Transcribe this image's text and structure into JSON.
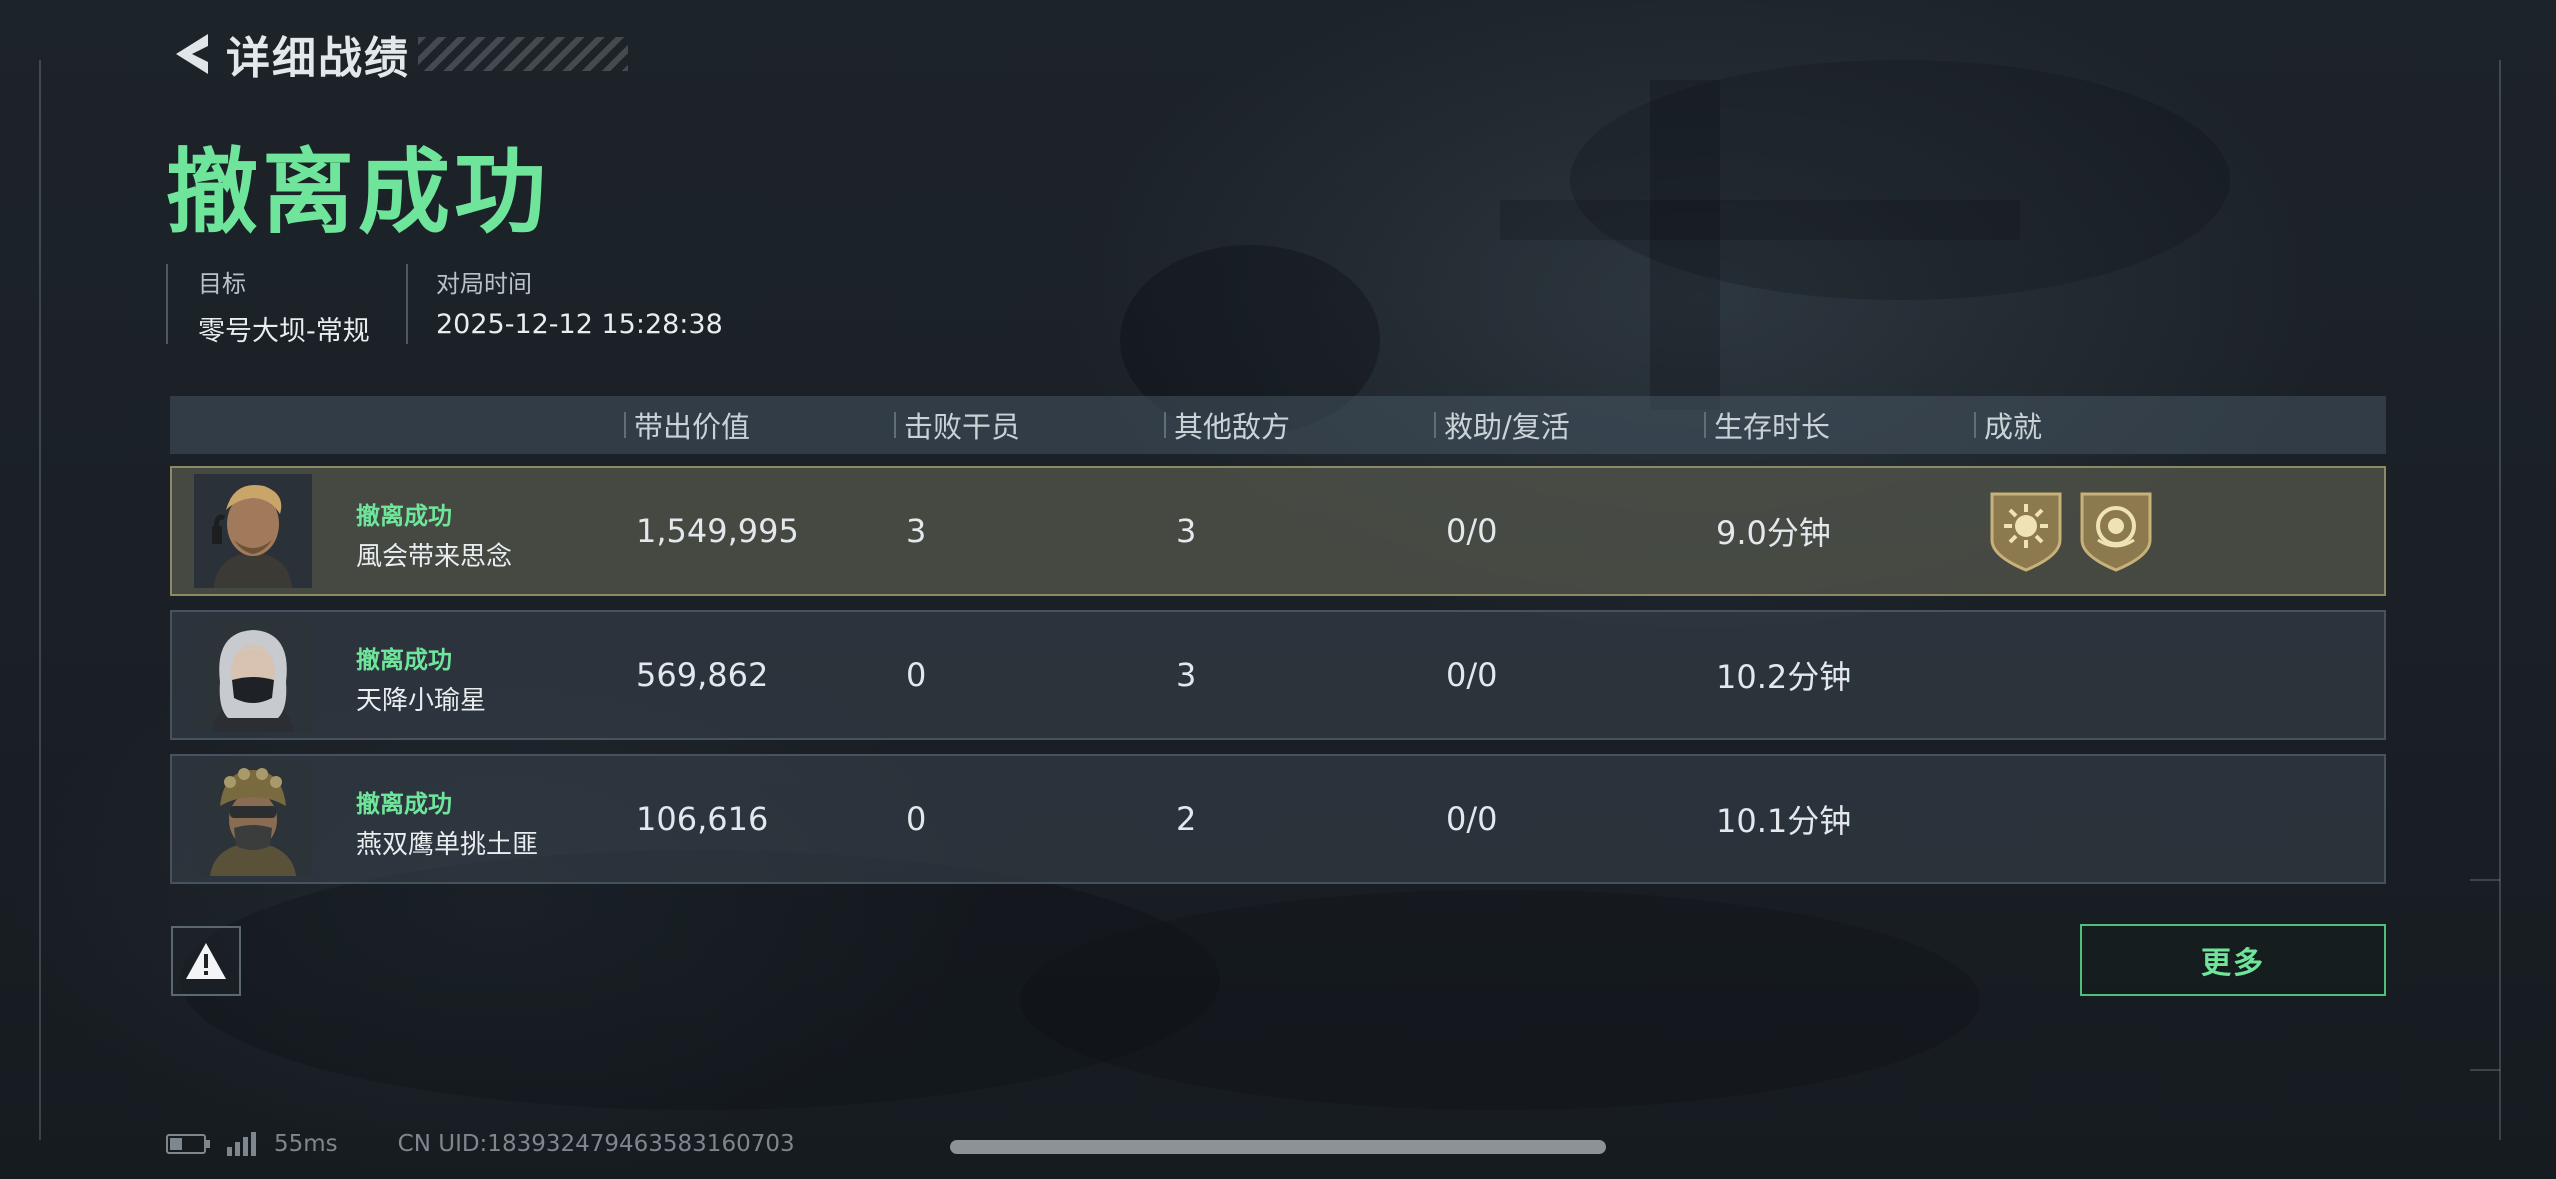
{
  "header": {
    "back_icon": "back-chevron-icon",
    "title": "详细战绩"
  },
  "result": {
    "title": "撤离成功",
    "accent": "#6fe59b"
  },
  "info": {
    "target_label": "目标",
    "target_value": "零号大坝-常规",
    "time_label": "对局时间",
    "time_value": "2025-12-12 15:28:38"
  },
  "table": {
    "columns": [
      "带出价值",
      "击败干员",
      "其他敌方",
      "救助/复活",
      "生存时长",
      "成就"
    ],
    "rows": [
      {
        "status": "撤离成功",
        "name": "風会带来思念",
        "value": "1,549,995",
        "kills": "3",
        "other": "3",
        "assist": "0/0",
        "survival": "9.0分钟",
        "highlight": true,
        "achievements": [
          "sun-emblem-badge-icon",
          "laurel-emblem-badge-icon"
        ]
      },
      {
        "status": "撤离成功",
        "name": "天降小瑜星",
        "value": "569,862",
        "kills": "0",
        "other": "3",
        "assist": "0/0",
        "survival": "10.2分钟",
        "highlight": false,
        "achievements": []
      },
      {
        "status": "撤离成功",
        "name": "燕双鹰单挑土匪",
        "value": "106,616",
        "kills": "0",
        "other": "2",
        "assist": "0/0",
        "survival": "10.1分钟",
        "highlight": false,
        "achievements": []
      }
    ]
  },
  "buttons": {
    "warning_icon": "warning-icon",
    "more_label": "更多"
  },
  "footer": {
    "ping": "55ms",
    "uid": "CN UID:183932479463583160703"
  }
}
